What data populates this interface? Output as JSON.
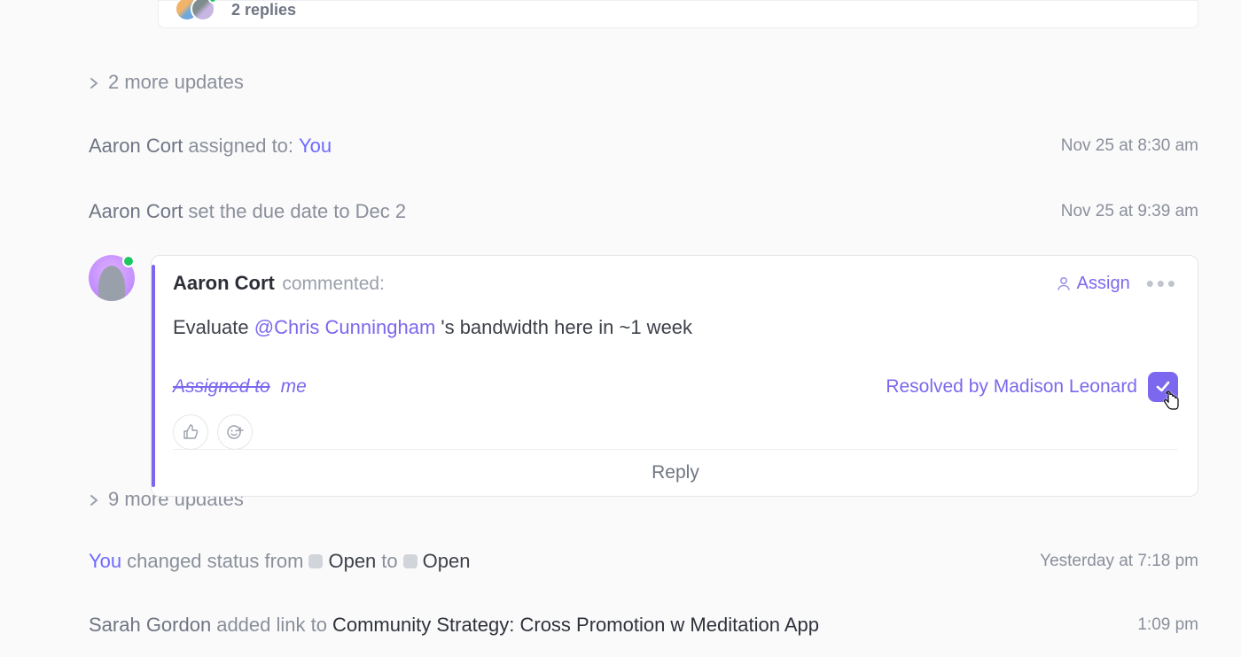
{
  "topCard": {
    "replies": "2 replies"
  },
  "moreUpdates1": "2 more updates",
  "moreUpdates2": "9 more updates",
  "events": {
    "assigned": {
      "actor": "Aaron Cort",
      "verb": "assigned to:",
      "target": "You",
      "time": "Nov 25 at 8:30 am"
    },
    "dueDate": {
      "actor": "Aaron Cort",
      "verb": "set the due date to",
      "value": "Dec 2",
      "time": "Nov 25 at 9:39 am"
    },
    "status": {
      "actor": "You",
      "verb": "changed status from",
      "from": "Open",
      "to": "Open",
      "mid": "to",
      "time": "Yesterday at 7:18 pm"
    },
    "link": {
      "actor": "Sarah Gordon",
      "verb": "added link to",
      "title": "Community Strategy: Cross Promotion w Meditation App",
      "time": "1:09 pm"
    }
  },
  "comment": {
    "author": "Aaron Cort",
    "verb": "commented:",
    "assignLabel": "Assign",
    "textPrefix": "Evaluate ",
    "mention": "@Chris Cunningham",
    "textSuffix": " 's bandwidth here in ~1 week",
    "assignedToLabel": "Assigned to",
    "assignedToValue": "me",
    "resolvedBy": "Resolved by Madison Leonard",
    "replyLabel": "Reply"
  }
}
